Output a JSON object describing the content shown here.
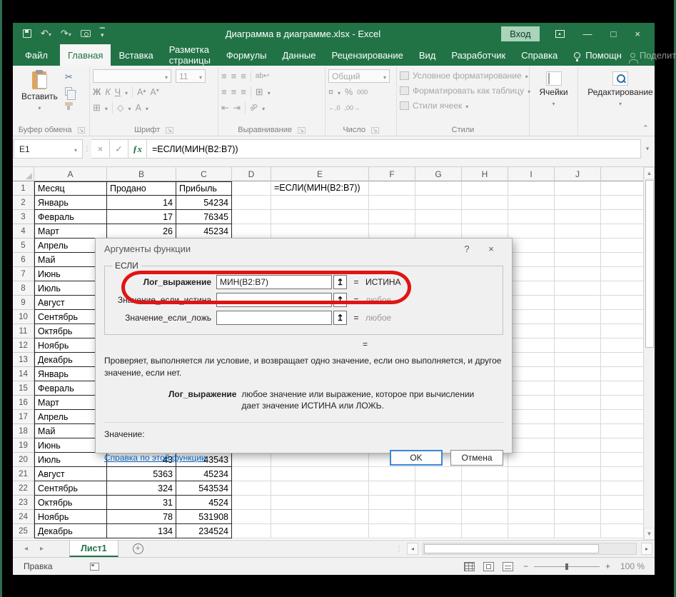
{
  "title_bar": {
    "title": "Диаграмма в диаграмме.xlsx - Excel",
    "signin": "Вход"
  },
  "ribbon_tabs": {
    "file": "Файл",
    "items": [
      "Главная",
      "Вставка",
      "Разметка страницы",
      "Формулы",
      "Данные",
      "Рецензирование",
      "Вид",
      "Разработчик",
      "Справка"
    ],
    "active": "Главная",
    "assistant": "Помощн",
    "share": "Поделиться"
  },
  "ribbon": {
    "clipboard_label": "Буфер обмена",
    "paste_label": "Вставить",
    "font_label": "Шрифт",
    "font_size": "11",
    "bold": "Ж",
    "italic": "К",
    "underline": "Ч",
    "grow_letter": "А",
    "shrink_letter": "А",
    "font_color_letter": "А",
    "align_label": "Выравнивание",
    "wrap_letters": "ab",
    "number_label": "Число",
    "number_format": "Общий",
    "currency_sign": "¤",
    "percent": "%",
    "thousands": "000",
    "inc_decimal": "←,0",
    "dec_decimal": ",00→",
    "styles_label": "Стили",
    "styles_items": [
      "Условное форматирование",
      "Форматировать как таблицу",
      "Стили ячеек"
    ],
    "cells_label": "Ячейки",
    "editing_label": "Редактирование"
  },
  "formula_bar": {
    "name_box": "E1",
    "fx": "ƒx",
    "formula": "=ЕСЛИ(МИН(B2:B7))"
  },
  "grid": {
    "col_headers": [
      "A",
      "B",
      "C",
      "D",
      "E",
      "F",
      "G",
      "H",
      "I",
      "J"
    ],
    "e1_text": "=ЕСЛИ(МИН(B2:B7))",
    "rows": [
      {
        "n": "1",
        "a": "Месяц",
        "b": "Продано",
        "c": "Прибыль"
      },
      {
        "n": "2",
        "a": "Январь",
        "b": "14",
        "c": "54234"
      },
      {
        "n": "3",
        "a": "Февраль",
        "b": "17",
        "c": "76345"
      },
      {
        "n": "4",
        "a": "Март",
        "b": "26",
        "c": "45234"
      },
      {
        "n": "5",
        "a": "Апрель",
        "b": "",
        "c": ""
      },
      {
        "n": "6",
        "a": "Май",
        "b": "",
        "c": ""
      },
      {
        "n": "7",
        "a": "Июнь",
        "b": "",
        "c": ""
      },
      {
        "n": "8",
        "a": "Июль",
        "b": "",
        "c": ""
      },
      {
        "n": "9",
        "a": "Август",
        "b": "",
        "c": ""
      },
      {
        "n": "10",
        "a": "Сентябрь",
        "b": "",
        "c": ""
      },
      {
        "n": "11",
        "a": "Октябрь",
        "b": "",
        "c": ""
      },
      {
        "n": "12",
        "a": "Ноябрь",
        "b": "",
        "c": ""
      },
      {
        "n": "13",
        "a": "Декабрь",
        "b": "",
        "c": ""
      },
      {
        "n": "14",
        "a": "Январь",
        "b": "",
        "c": ""
      },
      {
        "n": "15",
        "a": "Февраль",
        "b": "",
        "c": ""
      },
      {
        "n": "16",
        "a": "Март",
        "b": "",
        "c": ""
      },
      {
        "n": "17",
        "a": "Апрель",
        "b": "",
        "c": ""
      },
      {
        "n": "18",
        "a": "Май",
        "b": "",
        "c": ""
      },
      {
        "n": "19",
        "a": "Июнь",
        "b": "",
        "c": ""
      },
      {
        "n": "20",
        "a": "Июль",
        "b": "43",
        "c": "43543"
      },
      {
        "n": "21",
        "a": "Август",
        "b": "5363",
        "c": "45234"
      },
      {
        "n": "22",
        "a": "Сентябрь",
        "b": "324",
        "c": "543534"
      },
      {
        "n": "23",
        "a": "Октябрь",
        "b": "31",
        "c": "4524"
      },
      {
        "n": "24",
        "a": "Ноябрь",
        "b": "78",
        "c": "531908"
      },
      {
        "n": "25",
        "a": "Декабрь",
        "b": "134",
        "c": "234524"
      }
    ]
  },
  "dialog": {
    "title": "Аргументы функции",
    "help_button": "?",
    "function_name": "ЕСЛИ",
    "args": [
      {
        "label": "Лог_выражение",
        "value": "МИН(B2:B7)",
        "result": "ИСТИНА"
      },
      {
        "label": "Значение_если_истина",
        "value": "",
        "result": "любое"
      },
      {
        "label": "Значение_если_ложь",
        "value": "",
        "result": "любое"
      }
    ],
    "equals_sign": "=",
    "description": "Проверяет, выполняется ли условие, и возвращает одно значение, если оно выполняется, и другое значение, если нет.",
    "arg_help_label": "Лог_выражение",
    "arg_help_text": "любое значение или выражение, которое при вычислении дает значение ИСТИНА или ЛОЖЬ.",
    "value_label": "Значение:",
    "help_link": "Справка по этой функции",
    "ok_label": "OK",
    "cancel_label": "Отмена"
  },
  "sheet_bar": {
    "active_tab": "Лист1"
  },
  "status_bar": {
    "mode": "Правка",
    "zoom": "100 %"
  },
  "colors": {
    "brand_green": "#217346",
    "annotation_red": "#e01414",
    "link_blue": "#0563c1",
    "ok_border_blue": "#3a88d4",
    "signin_bg": "#a9d3bb"
  }
}
